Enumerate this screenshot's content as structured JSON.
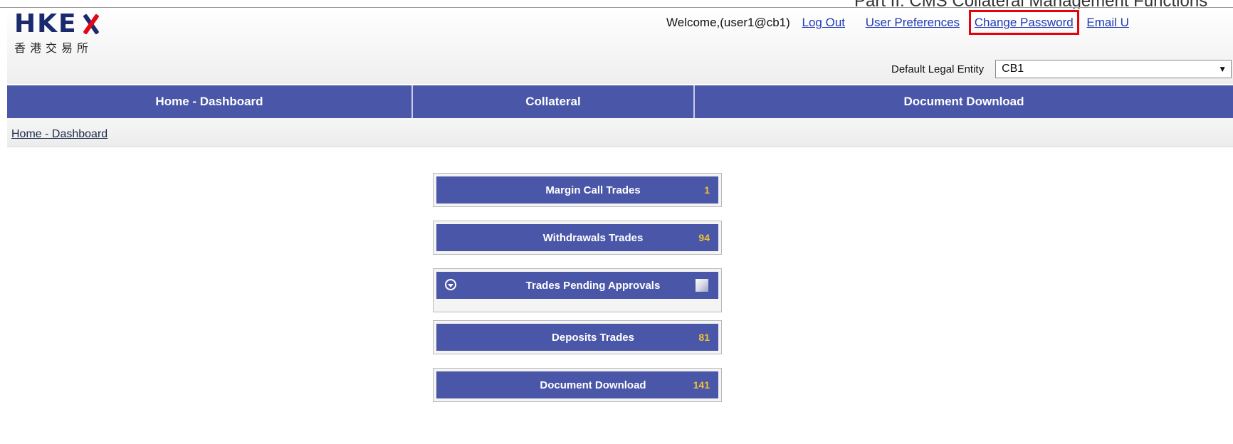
{
  "doc_header": {
    "title": "Part II: CMS Collateral Management Functions"
  },
  "logo": {
    "letters": "HKE",
    "letter_x": "X",
    "chinese": "香港交易所"
  },
  "user_bar": {
    "welcome": "Welcome,(user1@cb1)",
    "logout": "Log Out",
    "preferences": "User Preferences",
    "change_password": "Change Password",
    "email": "Email U"
  },
  "legal_entity": {
    "label": "Default Legal Entity",
    "value": "CB1"
  },
  "nav": [
    "Home - Dashboard",
    "Collateral",
    "Document Download"
  ],
  "breadcrumb": "Home - Dashboard",
  "dashboard": [
    {
      "label": "Margin Call Trades",
      "count": "1"
    },
    {
      "label": "Withdrawals Trades",
      "count": "94"
    },
    {
      "label": "Trades Pending Approvals",
      "count": ""
    },
    {
      "label": "Deposits Trades",
      "count": "81"
    },
    {
      "label": "Document Download",
      "count": "141"
    }
  ],
  "colors": {
    "nav_bg": "#4a56a8",
    "count_text": "#f1c232",
    "link": "#1f3ab5",
    "highlight": "#e8000b"
  }
}
